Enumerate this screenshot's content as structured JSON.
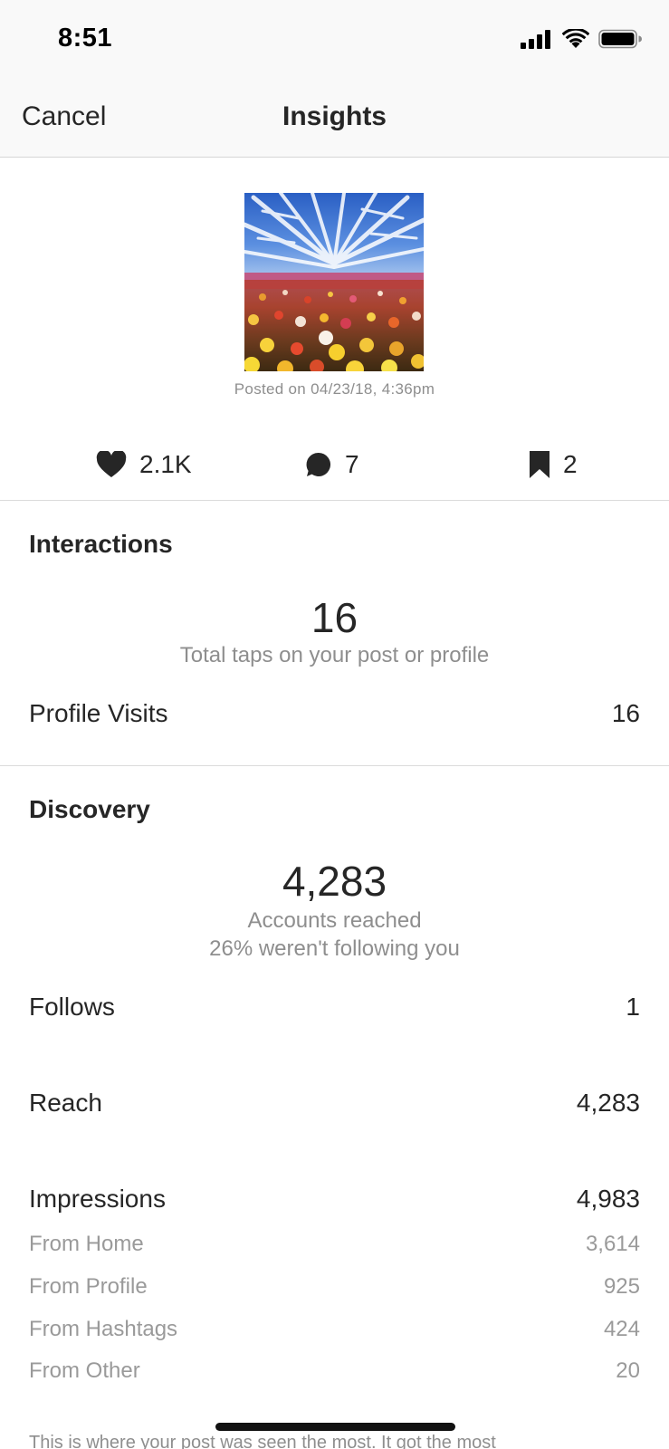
{
  "status_bar": {
    "time": "8:51",
    "icons": [
      "cellular-signal-icon",
      "wifi-icon",
      "battery-icon"
    ]
  },
  "nav": {
    "cancel_label": "Cancel",
    "title": "Insights"
  },
  "post": {
    "image": "flower-field-photo",
    "posted_on": "Posted on 04/23/18, 4:36pm"
  },
  "stats": {
    "likes": "2.1K",
    "comments": "7",
    "saves": "2"
  },
  "interactions": {
    "title": "Interactions",
    "total": "16",
    "total_caption": "Total taps on your post or profile",
    "rows": [
      {
        "label": "Profile Visits",
        "value": "16"
      }
    ]
  },
  "discovery": {
    "title": "Discovery",
    "accounts_reached": "4,283",
    "reached_caption": "Accounts reached",
    "not_following_caption": "26% weren't following you",
    "follows": {
      "label": "Follows",
      "value": "1"
    },
    "reach": {
      "label": "Reach",
      "value": "4,283"
    },
    "impressions": {
      "label": "Impressions",
      "value": "4,983"
    },
    "impression_sources": [
      {
        "label": "From Home",
        "value": "3,614"
      },
      {
        "label": "From Profile",
        "value": "925"
      },
      {
        "label": "From Hashtags",
        "value": "424"
      },
      {
        "label": "From Other",
        "value": "20"
      }
    ]
  },
  "footer": {
    "text": "This is where your post was seen the most. It got the most"
  },
  "colors": {
    "text_primary": "#262626",
    "text_secondary": "#8e8e8e",
    "bar_background": "#f9f9f9",
    "divider": "#dbdbdb"
  }
}
